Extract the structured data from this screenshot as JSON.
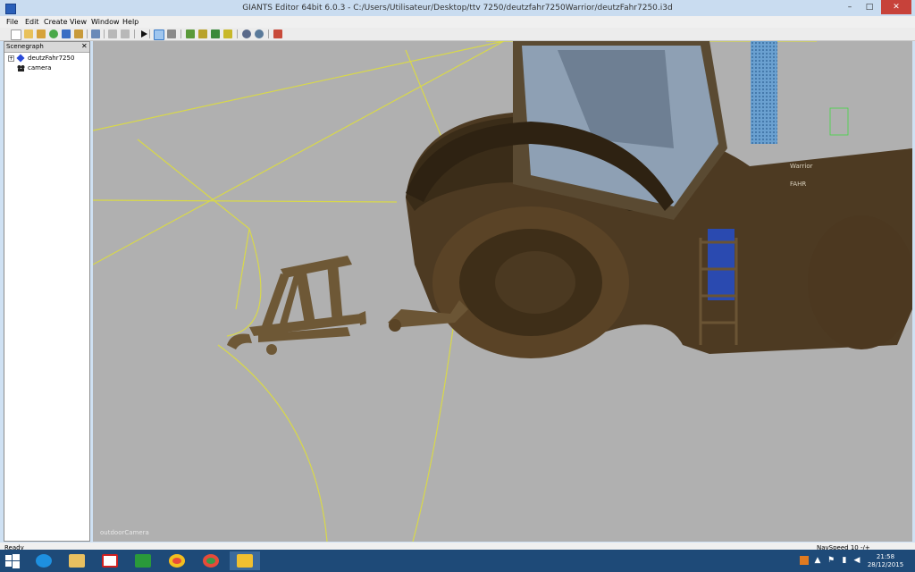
{
  "window": {
    "title": "GIANTS Editor 64bit 6.0.3 - C:/Users/Utilisateur/Desktop/ttv 7250/deutzfahr7250Warrior/deutzFahr7250.i3d",
    "minimize": "–",
    "maximize": "□",
    "close": "✕"
  },
  "menu": [
    "File",
    "Edit",
    "Create",
    "View",
    "Window",
    "Help"
  ],
  "toolbar": {
    "icons": [
      "new-file-icon",
      "open-file-icon",
      "edit-icon",
      "refresh-icon",
      "save-icon",
      "export-icon",
      "print-icon",
      "undo-icon",
      "redo-icon",
      "play-icon",
      "select-tool-icon",
      "move-tool-icon",
      "terrain-paint-icon",
      "terrain-sculpt-icon",
      "foliage-paint-icon",
      "terrain-smooth-icon",
      "settings-gear-icon",
      "options-gear-icon",
      "record-icon"
    ]
  },
  "scenegraph": {
    "title": "Scenegraph",
    "close": "✕",
    "items": [
      {
        "label": "deutzFahr7250",
        "icon": "transform-group-icon",
        "expander": "+"
      },
      {
        "label": "camera",
        "icon": "camera-icon",
        "expander": ""
      }
    ]
  },
  "viewport": {
    "camera_label": "outdoorCamera",
    "text_lines": [
      "FAHR",
      "Warrior"
    ]
  },
  "status": {
    "ready": "Ready",
    "navspeed": "NavSpeed 10 -/+"
  },
  "taskbar": {
    "apps": [
      "internet-explorer-icon",
      "file-explorer-icon",
      "nrj-radio-icon",
      "store-icon",
      "chrome-icon",
      "chrome-alt-icon",
      "giants-editor-icon"
    ],
    "clock_time": "21:58",
    "clock_date": "28/12/2015"
  }
}
